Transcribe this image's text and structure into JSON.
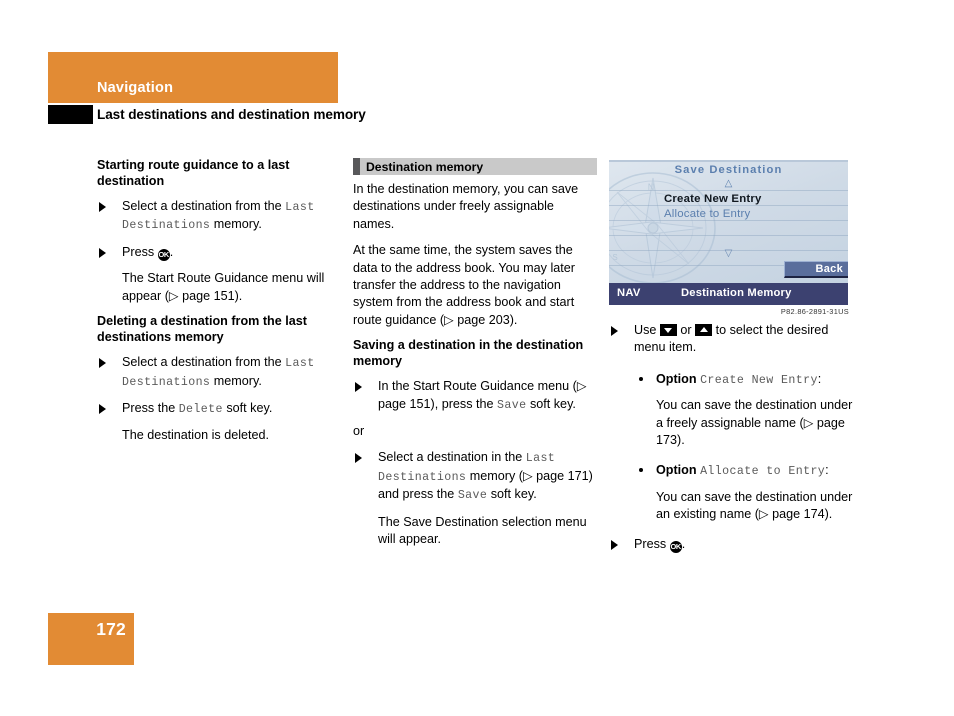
{
  "header": {
    "band_label": "Navigation",
    "subtitle": "Last destinations and destination memory",
    "band_color": "#E28B34",
    "tab_color": "#000000"
  },
  "col1": {
    "section1_title": "Starting route guidance to a last destination",
    "step1_a": "Select a destination from the ",
    "step1_mono": "Last Destinations",
    "step1_b": " memory.",
    "step2_a": "Press ",
    "step2_ok": "OK",
    "step2_b": ".",
    "step2_cont": "The Start Route Guidance menu will appear (▷ page 151).",
    "section2_title": "Deleting a destination from the last destinations memory",
    "step3_a": "Select a destination from the ",
    "step3_mono": "Last Destinations",
    "step3_b": " memory.",
    "step4_a": "Press the ",
    "step4_mono": "Delete",
    "step4_b": " soft key.",
    "step4_cont": "The destination is deleted."
  },
  "col2": {
    "bar_title": "Destination memory",
    "para1": "In the destination memory, you can save destinations under freely assignable names.",
    "para2": "At the same time, the system saves the data to the address book. You may later transfer the address to the navigation system from the address book and start route guidance (▷ page 203).",
    "section_title": "Saving a destination in the destination memory",
    "step1_a": "In the Start Route Guidance menu (▷ page 151), press the ",
    "step1_mono": "Save",
    "step1_b": " soft key.",
    "or_label": "or",
    "step2_a": "Select a destination in the ",
    "step2_mono": "Last Destinations",
    "step2_b": " memory (▷ page 171) and press the ",
    "step2_mono2": "Save",
    "step2_c": " soft key.",
    "step2_cont": "The Save Destination selection menu will appear."
  },
  "navshot": {
    "title": "Save Destination",
    "up_arrow": "△",
    "item1": "Create New Entry",
    "item2": "Allocate to Entry",
    "down_arrow": "▽",
    "back_label": "Back",
    "bottom_left": "NAV",
    "bottom_center": "Destination Memory",
    "figure_caption": "P82.86-2891-31US",
    "bar_color": "#3C4170",
    "accent_color": "#5B7FAE"
  },
  "col3": {
    "step1_a": "Use ",
    "step1_key_down": "down-arrow-key",
    "step1_b": " or ",
    "step1_key_up": "up-arrow-key",
    "step1_c": " to select the desired menu item.",
    "bullet1_label": "Option ",
    "bullet1_mono": "Create New Entry",
    "bullet1_colon": ":",
    "bullet1_cont": "You can save the destination under a freely assignable name (▷ page 173).",
    "bullet2_label": "Option ",
    "bullet2_mono": "Allocate to Entry",
    "bullet2_colon": ":",
    "bullet2_cont": "You can save the destination under an existing name (▷ page 174).",
    "step2_a": "Press ",
    "step2_ok": "OK",
    "step2_b": "."
  },
  "footer": {
    "page_number": "172",
    "box_color": "#E28B34"
  }
}
